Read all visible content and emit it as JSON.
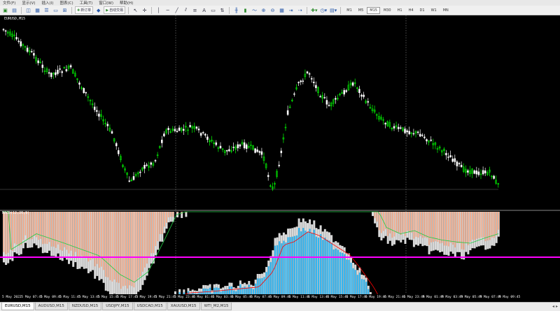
{
  "menu": [
    "文件(F)",
    "显示(V)",
    "插入(I)",
    "图表(C)",
    "工具(T)",
    "窗口(W)",
    "帮助(H)"
  ],
  "toolbar": {
    "new_order_label": "新订单",
    "autotrade_label": "自动交易",
    "timeframes": [
      "M1",
      "M5",
      "M15",
      "M30",
      "H1",
      "H4",
      "D1",
      "W1",
      "MN"
    ],
    "active_timeframe": "M15"
  },
  "chart": {
    "title": "EURUSD,M15",
    "indicator_title": "MACD(12,26,9)",
    "x_labels": [
      "5 May 2022",
      "5 May 07:45",
      "5 May 09:45",
      "5 May 11:45",
      "5 May 13:45",
      "5 May 15:45",
      "5 May 17:45",
      "5 May 19:45",
      "5 May 21:45",
      "5 May 23:45",
      "6 May 01:45",
      "6 May 03:45",
      "6 May 05:45",
      "6 May 07:45",
      "6 May 09:45",
      "6 May 11:45",
      "6 May 13:45",
      "6 May 15:45",
      "6 May 17:45",
      "6 May 19:45",
      "6 May 21:45",
      "6 May 23:45",
      "9 May 01:45",
      "9 May 03:45",
      "9 May 05:45",
      "9 May 07:45",
      "9 May 09:45"
    ]
  },
  "tabs": [
    "EURUSD,M15",
    "AUDUSD,M15",
    "NZDUSD,M15",
    "USDJPY,M15",
    "USDCAD,M15",
    "XAUUSD,M15",
    "WTI_M2,M15"
  ],
  "active_tab": "EURUSD,M15",
  "colors": {
    "background": "#000000",
    "bull_candle": "#00ff00",
    "bear_candle": "#ffffff",
    "hist_negative": "#f4a582",
    "hist_positive": "#33b5f0",
    "osma_shadow": "#d9d9d9",
    "signal_red": "#ff0000",
    "signal_green": "#22cc44",
    "magenta_level": "#ff00ff"
  }
}
